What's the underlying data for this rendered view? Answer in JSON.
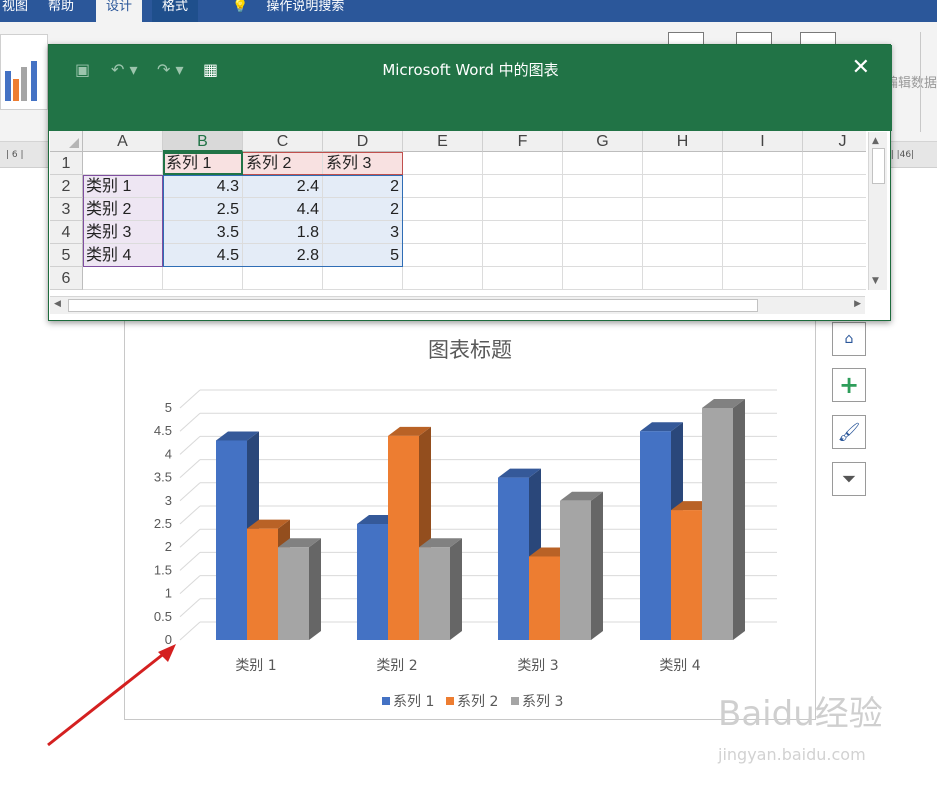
{
  "ribbon": {
    "tabs": [
      "视图",
      "帮助",
      "设计",
      "格式",
      "操作说明搜索"
    ],
    "right_label": "编辑数据"
  },
  "popup": {
    "title": "Microsoft Word 中的图表",
    "columns": [
      "A",
      "B",
      "C",
      "D",
      "E",
      "F",
      "G",
      "H",
      "I",
      "J"
    ],
    "rows": [
      "1",
      "2",
      "3",
      "4",
      "5",
      "6"
    ],
    "table": [
      [
        "",
        "系列 1",
        "系列 2",
        "系列 3"
      ],
      [
        "类别 1",
        "4.3",
        "2.4",
        "2"
      ],
      [
        "类别 2",
        "2.5",
        "4.4",
        "2"
      ],
      [
        "类别 3",
        "3.5",
        "1.8",
        "3"
      ],
      [
        "类别 4",
        "4.5",
        "2.8",
        "5"
      ]
    ]
  },
  "chart_data": {
    "type": "bar",
    "title": "图表标题",
    "categories": [
      "类别 1",
      "类别 2",
      "类别 3",
      "类别 4"
    ],
    "series": [
      {
        "name": "系列 1",
        "values": [
          4.3,
          2.5,
          3.5,
          4.5
        ],
        "color": "#4472c4"
      },
      {
        "name": "系列 2",
        "values": [
          2.4,
          4.4,
          1.8,
          2.8
        ],
        "color": "#ed7d31"
      },
      {
        "name": "系列 3",
        "values": [
          2,
          2,
          3,
          5
        ],
        "color": "#a5a5a5"
      }
    ],
    "yticks": [
      "0",
      "0.5",
      "1",
      "1.5",
      "2",
      "2.5",
      "3",
      "3.5",
      "4",
      "4.5",
      "5"
    ],
    "ylim": [
      0,
      5
    ],
    "legend": "bottom",
    "style": "3d-clustered-column"
  },
  "icons": {
    "save": "save-icon",
    "undo": "undo-icon",
    "redo": "redo-icon",
    "excel": "excel-icon",
    "close": "close-icon",
    "layout": "chart-layout-icon",
    "add": "chart-elements-icon",
    "brush": "chart-styles-icon",
    "filter": "chart-filter-icon"
  },
  "watermark": {
    "main": "Baidu经验",
    "sub": "jingyan.baidu.com"
  },
  "colors": {
    "excel_green": "#217346",
    "word_blue": "#2b579a",
    "arrow": "#d42020"
  }
}
